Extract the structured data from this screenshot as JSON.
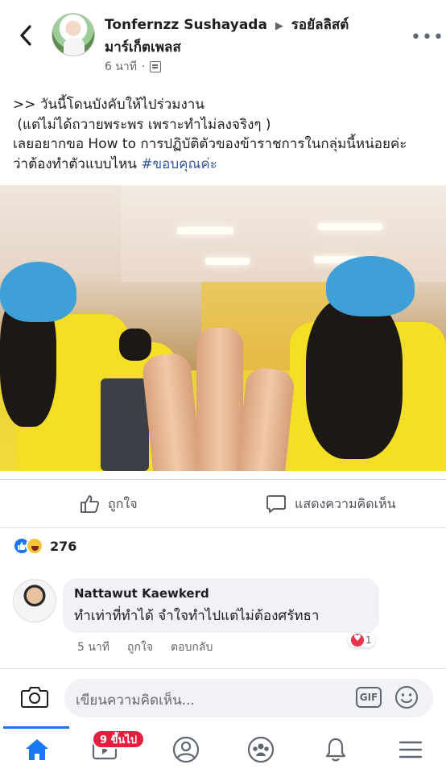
{
  "header": {
    "author": "Tonfernzz Sushayada",
    "group": "รอยัลลิสต์มาร์เก็ตเพลส",
    "time": "6 นาที",
    "privacy_icon": "group-icon",
    "back_icon": "chevron-left-icon",
    "more_icon": "more-icon"
  },
  "post": {
    "text": ">> วันนี้โดนบังคับให้ไปร่วมงาน\n (แต่ไม่ได้ถวายพระพร เพราะทำไม่ลงจริงๆ )\nเลยอยากขอ How to การปฏิบัติตัวของข้าราชการในกลุ่มนี้หน่อยค่ะ\nว่าต้องทำตัวแบบไหน ",
    "hashtag": "#ขอบคุณค่ะ"
  },
  "actions": {
    "like_label": "ถูกใจ",
    "comment_label": "แสดงความคิดเห็น"
  },
  "reactions": {
    "count": "276",
    "types": [
      "like",
      "haha"
    ]
  },
  "comment": {
    "name": "Nattawut Kaewkerd",
    "text": "ทำเท่าที่ทำได้ จำใจทำไปแต่ไม่ต้องศรัทธา",
    "time": "5 นาที",
    "like_label": "ถูกใจ",
    "reply_label": "ตอบกลับ",
    "reaction_count": "1"
  },
  "composer": {
    "placeholder": "เขียนความคิดเห็น...",
    "gif_label": "GIF"
  },
  "nav": {
    "badge": "9 ขึ้นไป",
    "items": [
      "home-icon",
      "watch-icon",
      "profile-icon",
      "groups-icon",
      "notifications-icon",
      "menu-icon"
    ]
  },
  "colors": {
    "accent": "#1877f2",
    "link": "#385898",
    "badge": "#e41e3f"
  }
}
